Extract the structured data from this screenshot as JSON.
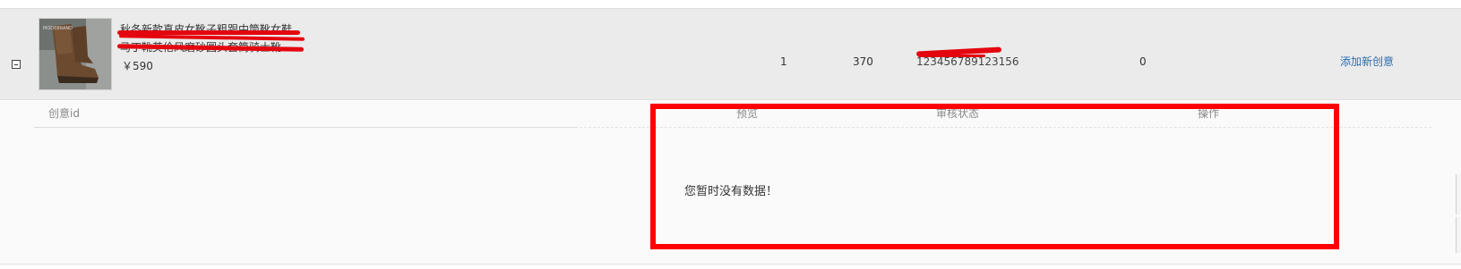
{
  "product": {
    "title_line_1": "秋冬新款真皮女靴子粗跟中筒靴女鞋",
    "title_line_2": "马丁靴英伦风磨砂圆头套筒骑士靴",
    "price": "￥590",
    "thumbnail": "boot-product-image",
    "count": "1",
    "bid": "370",
    "item_id": "123456789123156",
    "zero_value": "0",
    "add_creative_label": "添加新创意"
  },
  "creative_table": {
    "headers": [
      "创意id",
      "预览",
      "审核状态",
      "操作"
    ],
    "empty_message": "您暂时没有数据！"
  },
  "colors": {
    "row_background": "#ebebeb",
    "panel_background": "#fafafa",
    "link_color": "#2b6cb0",
    "highlight_color": "#ff0000",
    "redaction_color": "#e4060f"
  }
}
